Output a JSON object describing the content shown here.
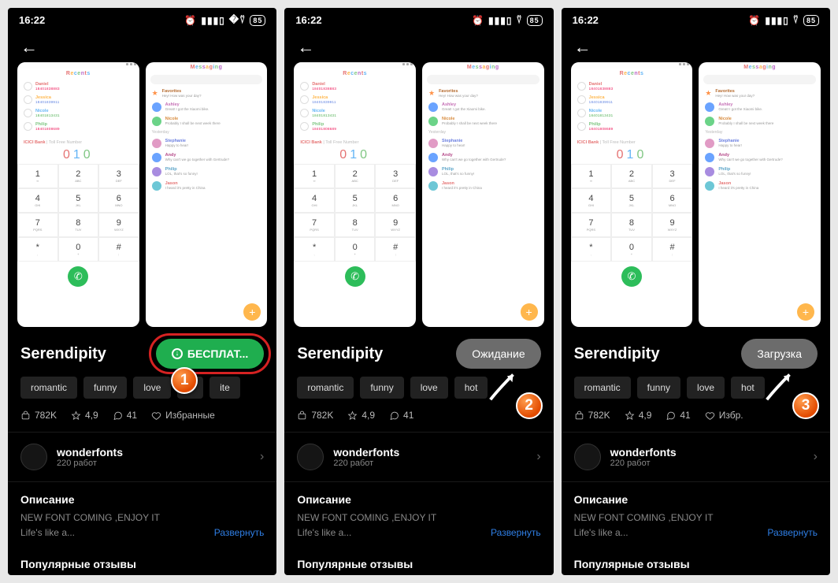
{
  "status": {
    "time": "16:22",
    "battery": "85"
  },
  "previews": {
    "dialer": {
      "title_chars": [
        "R",
        "e",
        "c",
        "e",
        "n",
        "t",
        "s"
      ],
      "recents": [
        {
          "name": "Daniel",
          "sub": "18401838883"
        },
        {
          "name": "Jessica",
          "sub": "18401839911"
        },
        {
          "name": "Nicole",
          "sub": "18401813431"
        },
        {
          "name": "Philip",
          "sub": "18401808689"
        }
      ],
      "bank": "ICICI Bank",
      "bank_sub": " | Toll Free Number",
      "num": "010",
      "keys": [
        {
          "n": "1",
          "l": "∞"
        },
        {
          "n": "2",
          "l": "ABC"
        },
        {
          "n": "3",
          "l": "DEF"
        },
        {
          "n": "4",
          "l": "GHI"
        },
        {
          "n": "5",
          "l": "JKL"
        },
        {
          "n": "6",
          "l": "MNO"
        },
        {
          "n": "7",
          "l": "PQRS"
        },
        {
          "n": "8",
          "l": "TUV"
        },
        {
          "n": "9",
          "l": "WXYZ"
        },
        {
          "n": "*",
          "l": ","
        },
        {
          "n": "0",
          "l": "+"
        },
        {
          "n": "#",
          "l": ";"
        }
      ]
    },
    "messaging": {
      "title_chars": [
        "M",
        "e",
        "s",
        "s",
        "a",
        "g",
        "i",
        "n",
        "g"
      ],
      "items": [
        {
          "name": "Favorites",
          "text": "Hey! How was your day?",
          "av": "or",
          "c": "c1"
        },
        {
          "name": "Ashley",
          "text": "Great! I got the Xiaomi bike.",
          "av": "bl",
          "c": "c2"
        },
        {
          "name": "Nicole",
          "text": "Probably I shall be next week there",
          "av": "gn",
          "c": "c3"
        },
        {
          "name": "Stephanie",
          "text": "Happy to hear!",
          "av": "pk",
          "c": "c4"
        },
        {
          "name": "Andy",
          "text": "Why can't we go together with Gertrude?",
          "av": "bl",
          "c": "c5"
        },
        {
          "name": "Philip",
          "text": "LOL, that's so funny!",
          "av": "pu",
          "c": "c6"
        },
        {
          "name": "Jason",
          "text": "I heard it's pretty in China",
          "av": "cy",
          "c": "c7"
        }
      ],
      "header": "Yesterday"
    }
  },
  "theme": {
    "title": "Serendipity"
  },
  "buttons": {
    "free": "БЕСПЛАТ...",
    "waiting": "Ожидание",
    "loading": "Загрузка"
  },
  "tags": {
    "romantic": "romantic",
    "funny": "funny",
    "love": "love",
    "hot": "hot",
    "cute": "cute"
  },
  "stats": {
    "downloads": "782K",
    "rating": "4,9",
    "comments": "41",
    "fav": "Избранные",
    "fav_short": "Избр."
  },
  "author": {
    "name": "wonderfonts",
    "sub": "220 работ"
  },
  "description": {
    "title": "Описание",
    "line1": "NEW FONT COMING ,ENJOY IT",
    "line2": "Life's like a...",
    "expand": "Развернуть"
  },
  "popular": {
    "title": "Популярные отзывы"
  },
  "steps": {
    "s1": "1",
    "s2": "2",
    "s3": "3"
  }
}
